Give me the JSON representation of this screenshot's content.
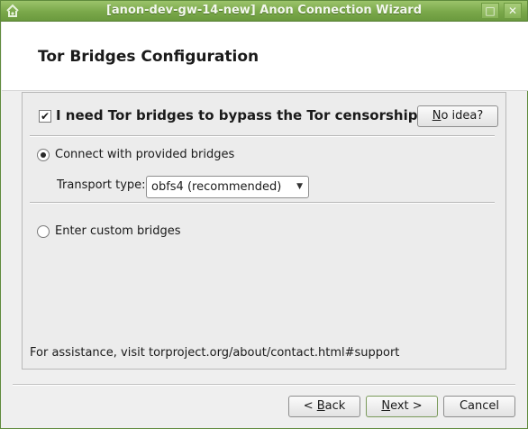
{
  "window": {
    "title": "[anon-dev-gw-14-new] Anon Connection Wizard",
    "maximize_glyph": "□",
    "close_glyph": "✕"
  },
  "page": {
    "title": "Tor Bridges Configuration"
  },
  "bridges": {
    "checkbox_checked": true,
    "checkbox_glyph": "✔",
    "checkbox_label": "I need Tor bridges to bypass the Tor censorship.",
    "no_idea_first": "N",
    "no_idea_rest": "o idea?"
  },
  "options": {
    "provided_label": "Connect with provided bridges",
    "provided_selected": true,
    "transport_label": "Transport type:",
    "transport_value": "obfs4 (recommended)",
    "custom_label": "Enter custom bridges",
    "custom_selected": false
  },
  "assistance": {
    "text": "For assistance, visit torproject.org/about/contact.html#support"
  },
  "footer": {
    "back_prefix": "< ",
    "back_ul": "B",
    "back_rest": "ack",
    "next_ul": "N",
    "next_rest": "ext >",
    "cancel_label": "Cancel"
  },
  "colors": {
    "titlebar": "#7aa84a",
    "window_bg": "#efefef",
    "header_bg": "#ffffff"
  },
  "icons": {
    "app": "app-logo-icon",
    "maximize": "maximize-icon",
    "close": "close-icon",
    "dropdown": "chevron-down-icon"
  }
}
